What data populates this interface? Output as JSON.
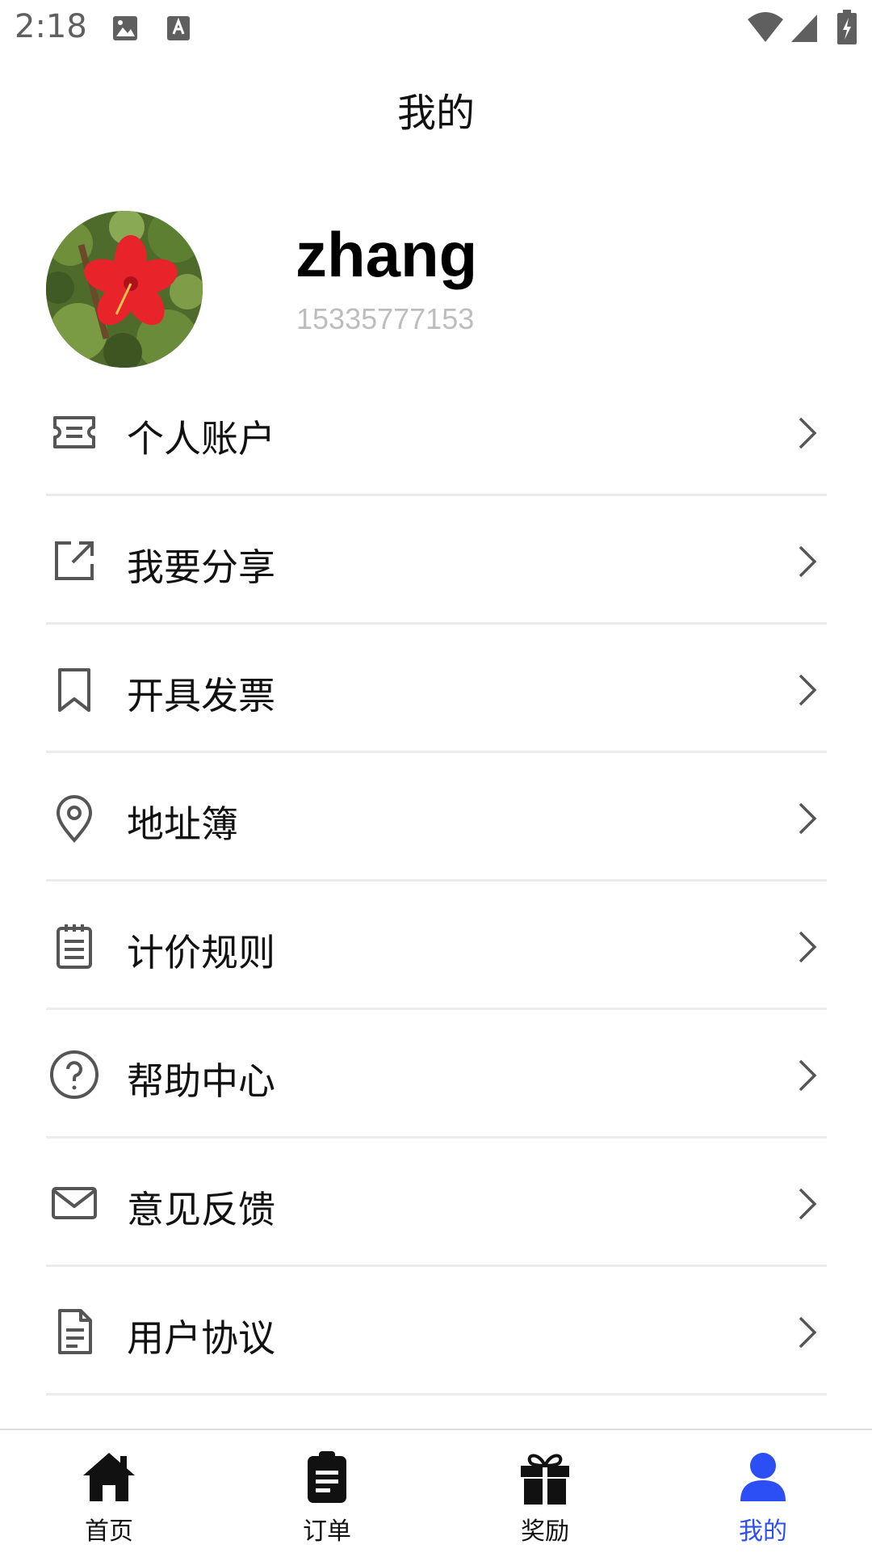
{
  "status_bar": {
    "time": "2:18"
  },
  "header": {
    "title": "我的"
  },
  "profile": {
    "username": "zhang",
    "phone": "15335777153"
  },
  "menu": [
    {
      "label": "个人账户",
      "icon": "ticket-icon"
    },
    {
      "label": "我要分享",
      "icon": "share-icon"
    },
    {
      "label": "开具发票",
      "icon": "bookmark-icon"
    },
    {
      "label": "地址簿",
      "icon": "location-pin-icon"
    },
    {
      "label": "计价规则",
      "icon": "clipboard-list-icon"
    },
    {
      "label": "帮助中心",
      "icon": "help-circle-icon"
    },
    {
      "label": "意见反馈",
      "icon": "mail-icon"
    },
    {
      "label": "用户协议",
      "icon": "document-icon"
    }
  ],
  "bottom_nav": [
    {
      "label": "首页",
      "icon": "home-icon"
    },
    {
      "label": "订单",
      "icon": "orders-icon"
    },
    {
      "label": "奖励",
      "icon": "gift-icon"
    },
    {
      "label": "我的",
      "icon": "user-icon"
    }
  ],
  "colors": {
    "accent": "#2b4ff5",
    "divider": "#ececec",
    "phone_text": "#bdbdbd"
  }
}
